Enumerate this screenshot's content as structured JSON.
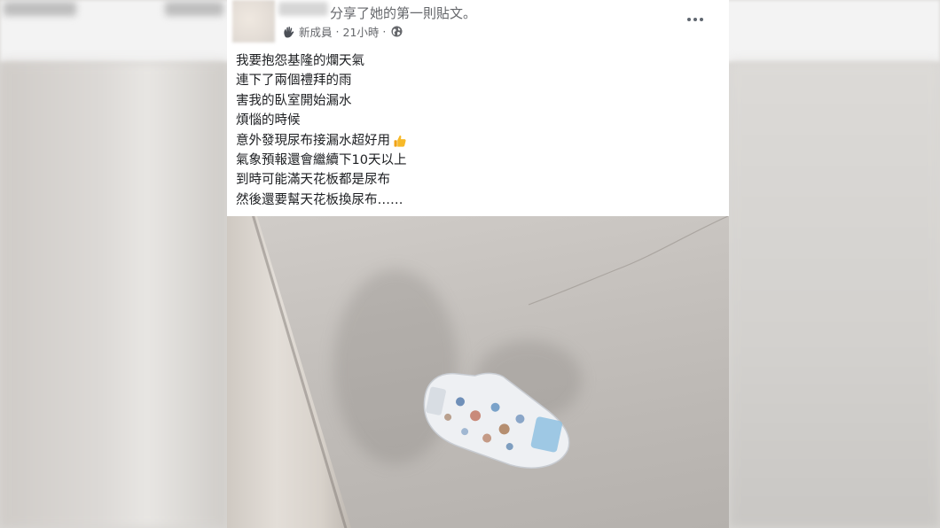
{
  "post": {
    "shared_text": "分享了她的第一則貼文。",
    "badge_label": "新成員",
    "separator": "·",
    "time_label": "21小時",
    "body_lines": [
      "我要抱怨基隆的爛天氣",
      "連下了兩個禮拜的雨",
      "害我的臥室開始漏水",
      "煩惱的時候",
      "意外發現尿布接漏水超好用",
      "氣象預報還會繼續下10天以上",
      "到時可能滿天花板都是尿布",
      "然後還要幫天花板換尿布……"
    ],
    "icons": {
      "badge": "new-member-wave-icon",
      "audience": "globe-icon",
      "options": "more-options-icon",
      "emoji": "thumbs-up-emoji"
    }
  },
  "colors": {
    "card_bg": "#ffffff",
    "text": "#1c1e21",
    "meta_text": "#65676b",
    "emoji": "#f7b928"
  }
}
